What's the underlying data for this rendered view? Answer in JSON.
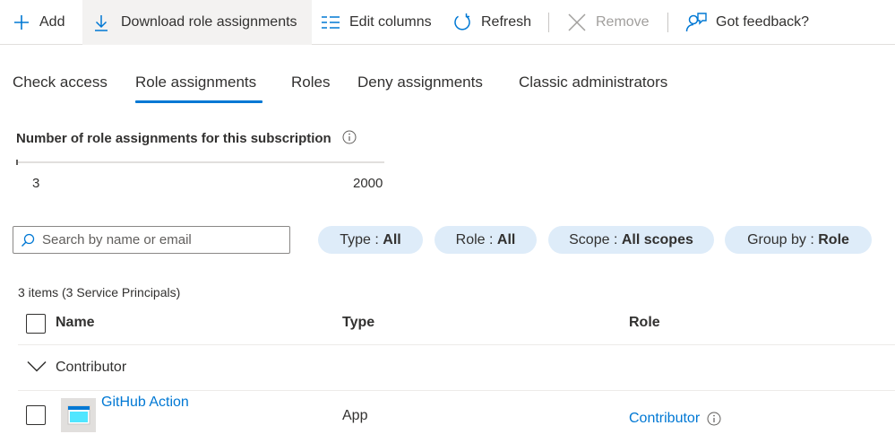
{
  "toolbar": {
    "add": "Add",
    "download": "Download role assignments",
    "edit_columns": "Edit columns",
    "refresh": "Refresh",
    "remove": "Remove",
    "feedback": "Got feedback?"
  },
  "tabs": [
    {
      "label": "Check access"
    },
    {
      "label": "Role assignments",
      "selected": true
    },
    {
      "label": "Roles"
    },
    {
      "label": "Deny assignments"
    },
    {
      "label": "Classic administrators"
    }
  ],
  "subscription": {
    "title": "Number of role assignments for this subscription",
    "current": "3",
    "max": "2000",
    "fill_fraction": 0.0015
  },
  "search": {
    "placeholder": "Search by name or email"
  },
  "filters": [
    {
      "key": "Type",
      "value": "All"
    },
    {
      "key": "Role",
      "value": "All"
    },
    {
      "key": "Scope",
      "value": "All scopes"
    },
    {
      "key": "Group by",
      "value": "Role"
    }
  ],
  "table": {
    "items_count": "3 items (3 Service Principals)",
    "columns": [
      "Name",
      "Type",
      "Role"
    ],
    "group": "Contributor",
    "rows": [
      {
        "name": "GitHub Action",
        "type": "App",
        "role": "Contributor"
      }
    ]
  },
  "colors": {
    "accent": "#0078d4",
    "pill_bg": "#deecf9"
  },
  "icons": [
    "add-icon",
    "download-icon",
    "edit-columns-icon",
    "refresh-icon",
    "remove-icon",
    "feedback-icon",
    "info-icon",
    "search-icon",
    "chevron-down-icon",
    "app-icon"
  ]
}
